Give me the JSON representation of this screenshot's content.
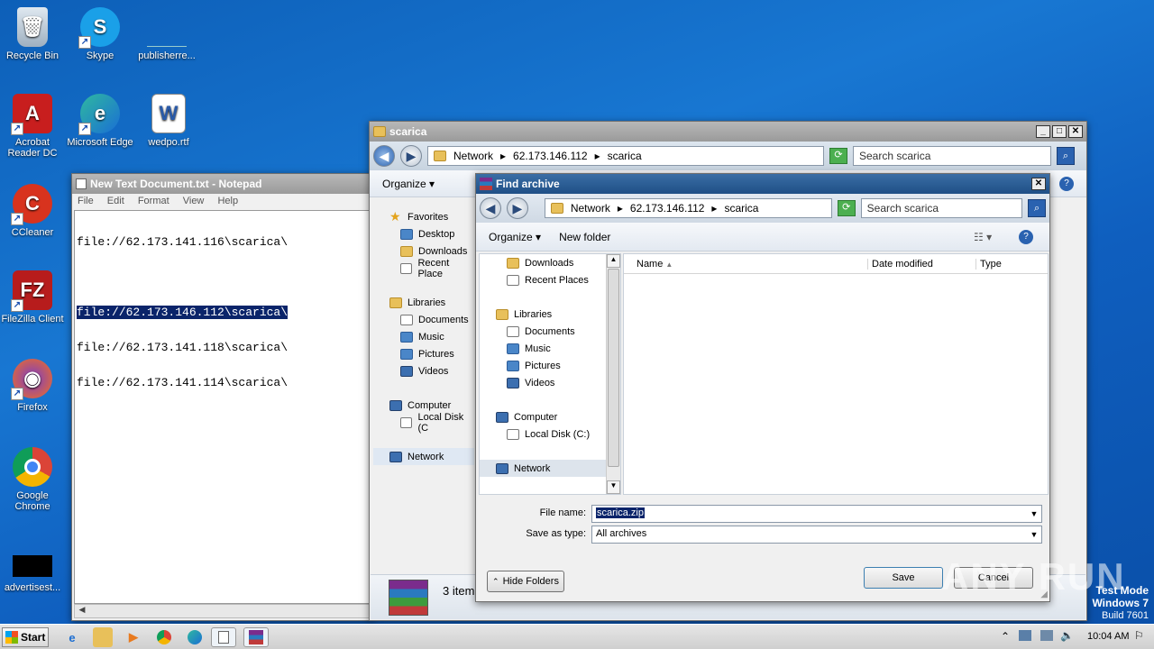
{
  "desktop": {
    "icons": [
      {
        "label": "Recycle Bin",
        "icon": "recycle-bin-icon"
      },
      {
        "label": "Skype",
        "icon": "skype-icon"
      },
      {
        "label": "publisherre...",
        "icon": "file-icon"
      },
      {
        "label": "Acrobat Reader DC",
        "icon": "acrobat-icon"
      },
      {
        "label": "Microsoft Edge",
        "icon": "edge-icon"
      },
      {
        "label": "wedpo.rtf",
        "icon": "word-doc-icon"
      },
      {
        "label": "CCleaner",
        "icon": "ccleaner-icon"
      },
      {
        "label": "FileZilla Client",
        "icon": "filezilla-icon"
      },
      {
        "label": "Firefox",
        "icon": "firefox-icon"
      },
      {
        "label": "Google Chrome",
        "icon": "chrome-icon"
      },
      {
        "label": "advertisest...",
        "icon": "black-file-icon"
      }
    ]
  },
  "notepad": {
    "title": "New Text Document.txt - Notepad",
    "menu": [
      "File",
      "Edit",
      "Format",
      "View",
      "Help"
    ],
    "lines": [
      "file://62.173.141.116\\scarica\\",
      "",
      "file://62.173.146.112\\scarica\\",
      "file://62.173.141.118\\scarica\\",
      "file://62.173.141.114\\scarica\\"
    ]
  },
  "explorer": {
    "title": "scarica",
    "breadcrumb": [
      "Network",
      "62.173.146.112",
      "scarica"
    ],
    "search_placeholder": "Search scarica",
    "organize_label": "Organize",
    "nav": {
      "favorites": "Favorites",
      "desktop": "Desktop",
      "downloads": "Downloads",
      "recent": "Recent Place",
      "libraries": "Libraries",
      "documents": "Documents",
      "music": "Music",
      "pictures": "Pictures",
      "videos": "Videos",
      "computer": "Computer",
      "localdisk": "Local Disk (C",
      "network": "Network"
    },
    "status": "3 item"
  },
  "dialog": {
    "title": "Find archive",
    "breadcrumb": [
      "Network",
      "62.173.146.112",
      "scarica"
    ],
    "search_placeholder": "Search scarica",
    "organize_label": "Organize",
    "new_folder_label": "New folder",
    "nav": {
      "downloads": "Downloads",
      "recent": "Recent Places",
      "libraries": "Libraries",
      "documents": "Documents",
      "music": "Music",
      "pictures": "Pictures",
      "videos": "Videos",
      "computer": "Computer",
      "localdisk": "Local Disk (C:)",
      "network": "Network"
    },
    "columns": {
      "name": "Name",
      "date": "Date modified",
      "type": "Type"
    },
    "file_name_label": "File name:",
    "file_name_value": "scarica.zip",
    "save_type_label": "Save as type:",
    "save_type_value": "All archives",
    "hide_folders_label": "Hide Folders",
    "save_label": "Save",
    "cancel_label": "Cancel"
  },
  "watermark": {
    "brand": "ANY RUN",
    "line1": "Test Mode",
    "line2": "Windows 7",
    "line3": "Build 7601"
  },
  "taskbar": {
    "start_label": "Start",
    "clock": "10:04 AM"
  }
}
